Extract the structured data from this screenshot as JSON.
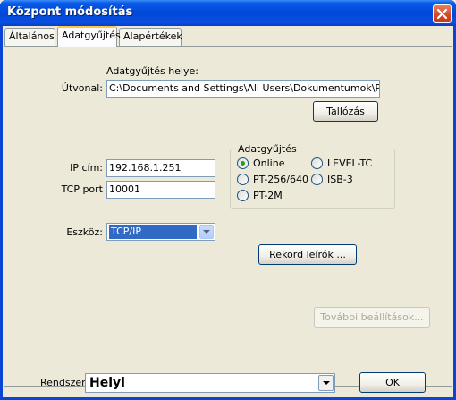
{
  "window": {
    "title": "Központ módosítás"
  },
  "tabs": [
    {
      "label": "Általános"
    },
    {
      "label": "Adatgyűjtés"
    },
    {
      "label": "Alapértékek"
    }
  ],
  "path": {
    "section_label": "Adatgyűjtés helye:",
    "label": "Útvonal:",
    "value": "C:\\Documents and Settings\\All Users\\Dokumentumok\\Proble",
    "browse_button": "Tallózás"
  },
  "network": {
    "ip_label": "IP cím:",
    "ip_value": "192.168.1.251",
    "port_label": "TCP port",
    "port_value": "10001"
  },
  "collection_group": {
    "title": "Adatgyűjtés",
    "options": [
      {
        "label": "Online",
        "checked": true
      },
      {
        "label": "LEVEL-TC",
        "checked": false
      },
      {
        "label": "PT-256/640",
        "checked": false
      },
      {
        "label": "ISB-3",
        "checked": false
      },
      {
        "label": "PT-2M",
        "checked": false
      }
    ]
  },
  "device": {
    "label": "Eszköz:",
    "value": "TCP/IP"
  },
  "record_button": "Rekord leírók ...",
  "more_settings_button": "További beállítások...",
  "system": {
    "label": "Rendszer:",
    "value": "Helyi"
  },
  "ok_button": "OK",
  "colors": {
    "titlebar": "#0047d8",
    "selection": "#316ac5",
    "face": "#ece9d8"
  },
  "icons": {
    "close": "close-icon",
    "dropdown": "chevron-down-icon"
  }
}
